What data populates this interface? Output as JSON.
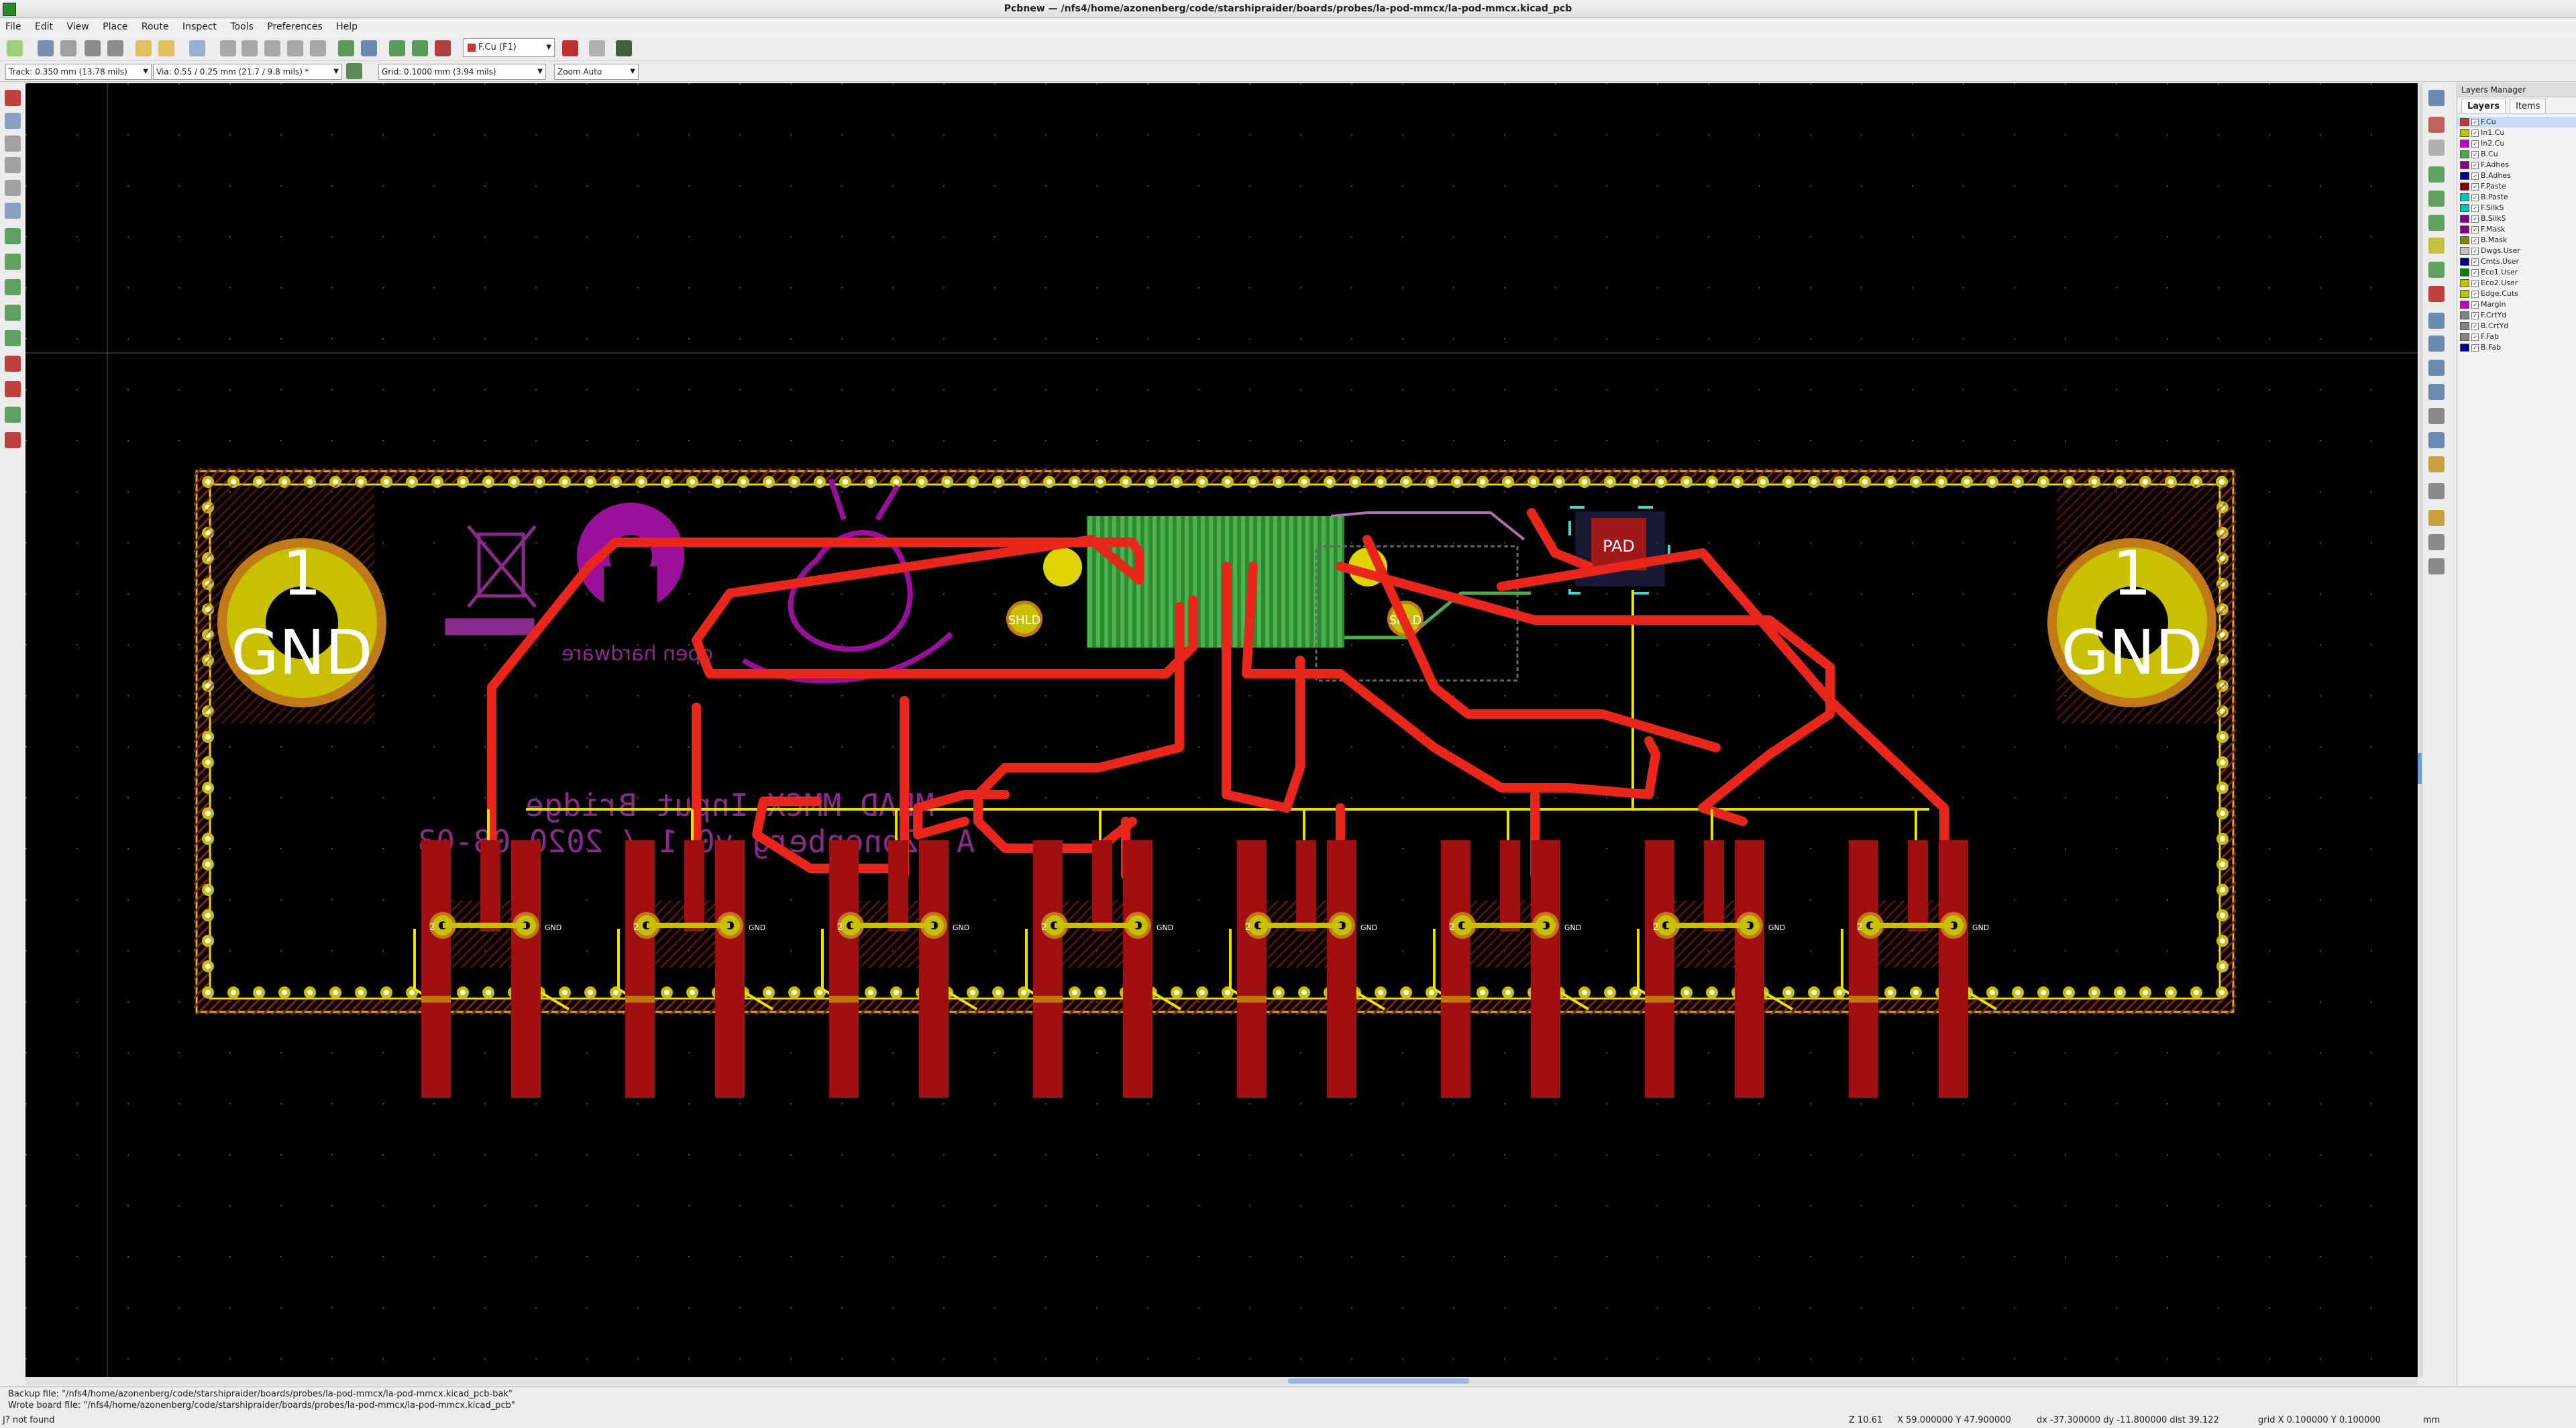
{
  "window": {
    "title": "Pcbnew — /nfs4/home/azonenberg/code/starshipraider/boards/probes/la-pod-mmcx/la-pod-mmcx.kicad_pcb"
  },
  "menu": [
    "File",
    "Edit",
    "View",
    "Place",
    "Route",
    "Inspect",
    "Tools",
    "Preferences",
    "Help"
  ],
  "toolbar": {
    "layer_select": "F.Cu (F1)",
    "track": "Track: 0.350 mm (13.78 mils)",
    "via": "Via: 0.55 / 0.25 mm (21.7 / 9.8 mils) *",
    "grid": "Grid: 0.1000 mm (3.94 mils)",
    "zoom": "Zoom Auto"
  },
  "layers_panel": {
    "title": "Layers Manager",
    "tabs": [
      "Layers",
      "Items"
    ],
    "layers": [
      {
        "name": "F.Cu",
        "color": "#c83434"
      },
      {
        "name": "In1.Cu",
        "color": "#c2c200"
      },
      {
        "name": "In2.Cu",
        "color": "#c200c2"
      },
      {
        "name": "B.Cu",
        "color": "#4dab4d"
      },
      {
        "name": "F.Adhes",
        "color": "#840084"
      },
      {
        "name": "B.Adhes",
        "color": "#000084"
      },
      {
        "name": "F.Paste",
        "color": "#840000"
      },
      {
        "name": "B.Paste",
        "color": "#00c2c2"
      },
      {
        "name": "F.SilkS",
        "color": "#00c2c2"
      },
      {
        "name": "B.SilkS",
        "color": "#840084"
      },
      {
        "name": "F.Mask",
        "color": "#840084"
      },
      {
        "name": "B.Mask",
        "color": "#848400"
      },
      {
        "name": "Dwgs.User",
        "color": "#c2c2c2"
      },
      {
        "name": "Cmts.User",
        "color": "#000084"
      },
      {
        "name": "Eco1.User",
        "color": "#008400"
      },
      {
        "name": "Eco2.User",
        "color": "#c2c200"
      },
      {
        "name": "Edge.Cuts",
        "color": "#c2c200"
      },
      {
        "name": "Margin",
        "color": "#c200c2"
      },
      {
        "name": "F.CrtYd",
        "color": "#848484"
      },
      {
        "name": "B.CrtYd",
        "color": "#848484"
      },
      {
        "name": "F.Fab",
        "color": "#848484"
      },
      {
        "name": "B.Fab",
        "color": "#000084"
      }
    ]
  },
  "board": {
    "mount_pad": {
      "number": "1",
      "net": "GND"
    },
    "shield_label": "SHLD",
    "pad_label": "PAD",
    "silk_line1": "MEAD MMCX Input Bridge",
    "silk_line2": "A. Zonenberg  v0.1 / 2020-08-03",
    "oshw_text": "open hardware",
    "connector_count": 8,
    "connector_pin": "2",
    "connector_net": "GND"
  },
  "messages": {
    "line1": "Backup file: \"/nfs4/home/azonenberg/code/starshipraider/boards/probes/la-pod-mmcx/la-pod-mmcx.kicad_pcb-bak\"",
    "line2": "Wrote board file: \"/nfs4/home/azonenberg/code/starshipraider/boards/probes/la-pod-mmcx/la-pod-mmcx.kicad_pcb\"",
    "line3": "J? not found"
  },
  "status": {
    "zoom": "Z 10.61",
    "abs": "X 59.000000  Y 47.900000",
    "rel": "dx -37.300000  dy -11.800000  dist 39.122",
    "grid": "grid X 0.100000  Y 0.100000",
    "units": "mm"
  }
}
